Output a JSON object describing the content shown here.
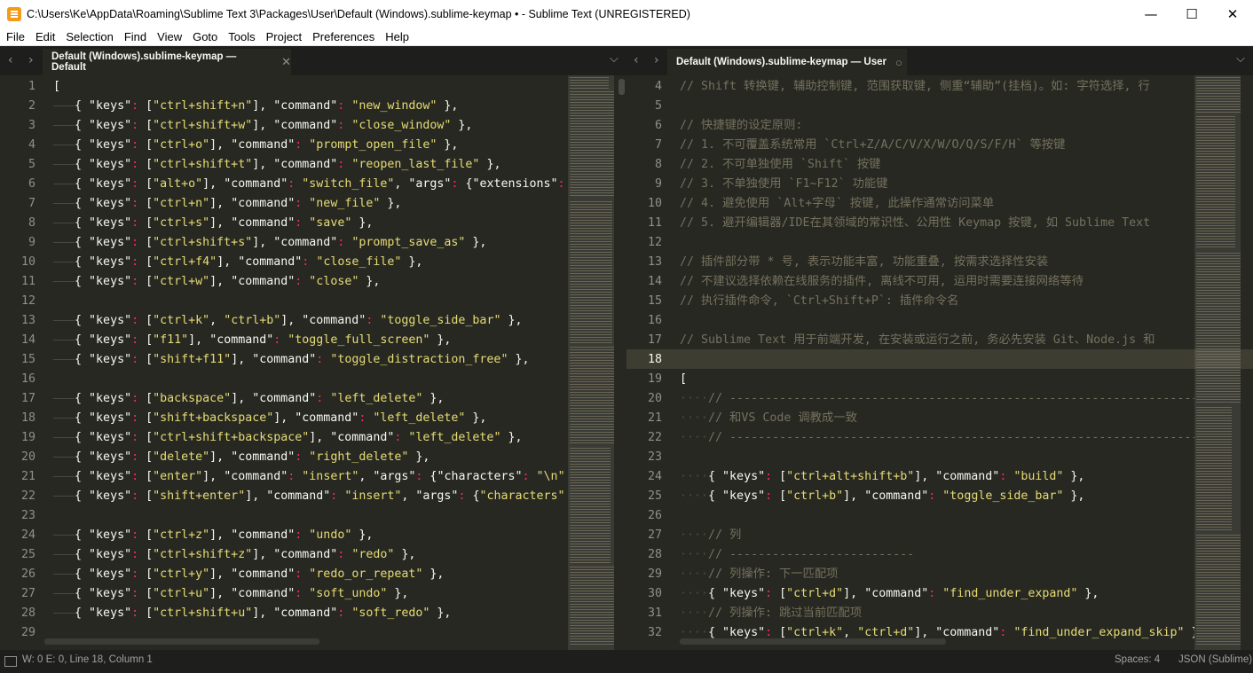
{
  "window": {
    "title": "C:\\Users\\Ke\\AppData\\Roaming\\Sublime Text 3\\Packages\\User\\Default (Windows).sublime-keymap • - Sublime Text (UNREGISTERED)",
    "min_glyph": "—",
    "max_glyph": "☐",
    "close_glyph": "✕"
  },
  "menu": [
    "File",
    "Edit",
    "Selection",
    "Find",
    "View",
    "Goto",
    "Tools",
    "Project",
    "Preferences",
    "Help"
  ],
  "left_tab": {
    "label": "Default (Windows).sublime-keymap — Default",
    "close": "✕"
  },
  "right_tab": {
    "label": "Default (Windows).sublime-keymap — User",
    "dirty": "○"
  },
  "nav": {
    "back": "‹",
    "forward": "›",
    "dropdown": "⌵"
  },
  "left_lines": [
    "1",
    "2",
    "3",
    "4",
    "5",
    "6",
    "7",
    "8",
    "9",
    "10",
    "11",
    "12",
    "13",
    "14",
    "15",
    "16",
    "17",
    "18",
    "19",
    "20",
    "21",
    "22",
    "23",
    "24",
    "25",
    "26",
    "27",
    "28",
    "29"
  ],
  "left_code": [
    "[",
    "\t{ \"keys\": [\"ctrl+shift+n\"], \"command\": \"new_window\" },",
    "\t{ \"keys\": [\"ctrl+shift+w\"], \"command\": \"close_window\" },",
    "\t{ \"keys\": [\"ctrl+o\"], \"command\": \"prompt_open_file\" },",
    "\t{ \"keys\": [\"ctrl+shift+t\"], \"command\": \"reopen_last_file\" },",
    "\t{ \"keys\": [\"alt+o\"], \"command\": \"switch_file\", \"args\": {\"extensions\":",
    "\t{ \"keys\": [\"ctrl+n\"], \"command\": \"new_file\" },",
    "\t{ \"keys\": [\"ctrl+s\"], \"command\": \"save\" },",
    "\t{ \"keys\": [\"ctrl+shift+s\"], \"command\": \"prompt_save_as\" },",
    "\t{ \"keys\": [\"ctrl+f4\"], \"command\": \"close_file\" },",
    "\t{ \"keys\": [\"ctrl+w\"], \"command\": \"close\" },",
    "",
    "\t{ \"keys\": [\"ctrl+k\", \"ctrl+b\"], \"command\": \"toggle_side_bar\" },",
    "\t{ \"keys\": [\"f11\"], \"command\": \"toggle_full_screen\" },",
    "\t{ \"keys\": [\"shift+f11\"], \"command\": \"toggle_distraction_free\" },",
    "",
    "\t{ \"keys\": [\"backspace\"], \"command\": \"left_delete\" },",
    "\t{ \"keys\": [\"shift+backspace\"], \"command\": \"left_delete\" },",
    "\t{ \"keys\": [\"ctrl+shift+backspace\"], \"command\": \"left_delete\" },",
    "\t{ \"keys\": [\"delete\"], \"command\": \"right_delete\" },",
    "\t{ \"keys\": [\"enter\"], \"command\": \"insert\", \"args\": {\"characters\": \"\\n\"",
    "\t{ \"keys\": [\"shift+enter\"], \"command\": \"insert\", \"args\": {\"characters\"",
    "",
    "\t{ \"keys\": [\"ctrl+z\"], \"command\": \"undo\" },",
    "\t{ \"keys\": [\"ctrl+shift+z\"], \"command\": \"redo\" },",
    "\t{ \"keys\": [\"ctrl+y\"], \"command\": \"redo_or_repeat\" },",
    "\t{ \"keys\": [\"ctrl+u\"], \"command\": \"soft_undo\" },",
    "\t{ \"keys\": [\"ctrl+shift+u\"], \"command\": \"soft_redo\" },",
    ""
  ],
  "right_lines": [
    "4",
    "5",
    "6",
    "7",
    "8",
    "9",
    "10",
    "11",
    "12",
    "13",
    "14",
    "15",
    "16",
    "17",
    "18",
    "19",
    "20",
    "21",
    "22",
    "23",
    "24",
    "25",
    "26",
    "27",
    "28",
    "29",
    "30",
    "31",
    "32"
  ],
  "right_code": [
    "// Shift 转换键, 辅助控制键, 范围获取键, 侧重“辅助”(挂档)。如: 字符选择, 行",
    "",
    "// 快捷键的设定原则:",
    "// 1. 不可覆盖系统常用 `Ctrl+Z/A/C/V/X/W/O/Q/S/F/H` 等按键",
    "// 2. 不可单独使用 `Shift` 按键",
    "// 3. 不单独使用 `F1~F12` 功能键",
    "// 4. 避免使用 `Alt+字母` 按键, 此操作通常访问菜单",
    "// 5. 避开编辑器/IDE在其领域的常识性、公用性 Keymap 按键, 如 Sublime Text",
    "",
    "// 插件部分带 * 号, 表示功能丰富, 功能重叠, 按需求选择性安装",
    "// 不建议选择依赖在线服务的插件, 离线不可用, 运用时需要连接网络等待",
    "// 执行插件命令, `Ctrl+Shift+P`: 插件命令名",
    "",
    "// Sublime Text 用于前端开发, 在安装或运行之前, 务必先安装 Git、Node.js 和",
    "",
    "[",
    "    // ------------------------------------------------------------------",
    "    // 和VS Code 调教成一致",
    "    // ------------------------------------------------------------------",
    "",
    "    { \"keys\": [\"ctrl+alt+shift+b\"], \"command\": \"build\" },",
    "    { \"keys\": [\"ctrl+b\"], \"command\": \"toggle_side_bar\" },",
    "",
    "    // 列",
    "    // --------------------------",
    "    // 列操作: 下一匹配项",
    "    { \"keys\": [\"ctrl+d\"], \"command\": \"find_under_expand\" },",
    "    // 列操作: 跳过当前匹配项",
    "    { \"keys\": [\"ctrl+k\", \"ctrl+d\"], \"command\": \"find_under_expand_skip\" }"
  ],
  "status": {
    "left": "W: 0 E: 0, Line 18, Column 1",
    "spaces": "Spaces: 4",
    "syntax": "JSON (Sublime)"
  },
  "colors": {
    "background": "#272822",
    "string": "#e6db74",
    "comment": "#75715e",
    "current_line": "#3e3d32"
  }
}
